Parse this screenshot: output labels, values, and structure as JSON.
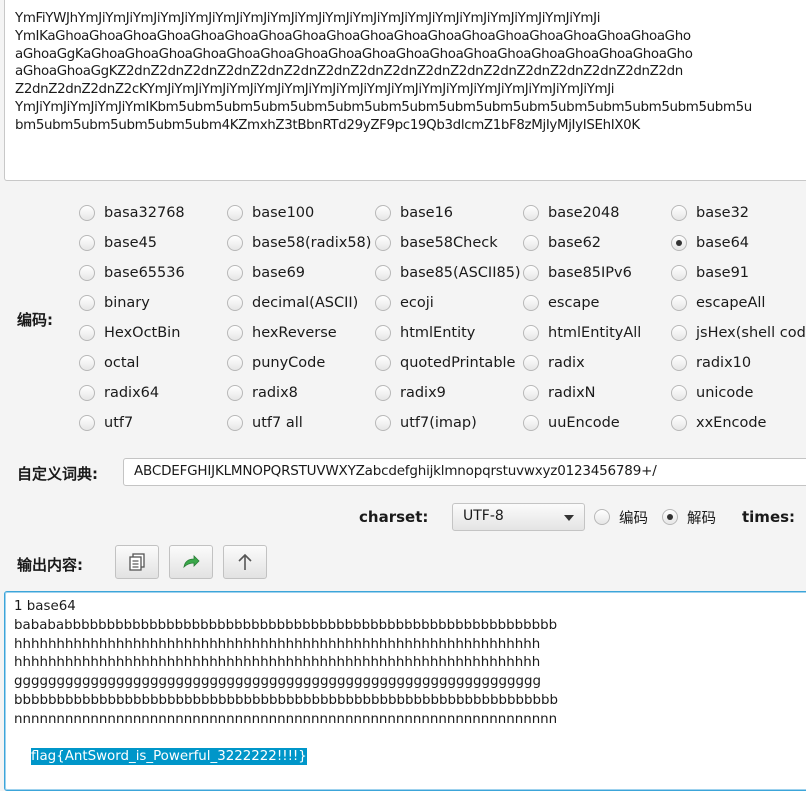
{
  "input_lines": [
    "YmFiYWJhYmJiYmJiYmJiYmJiYmJiYmJiYmJiYmJiYmJiYmJiYmJiYmJiYmJiYmJiYmJiYmJiYmJiYmJiYmJi",
    "YmIKaGhoaGhoaGhoaGhoaGhoaGhoaGhoaGhoaGhoaGhoaGhoaGhoaGhoaGhoaGhoaGhoaGhoaGhoaGho",
    "aGhoaGgKaGhoaGhoaGhoaGhoaGhoaGhoaGhoaGhoaGhoaGhoaGhoaGhoaGhoaGhoaGhoaGhoaGhoaGho",
    "aGhoaGhoaGgKZ2dnZ2dnZ2dnZ2dnZ2dnZ2dnZ2dnZ2dnZ2dnZ2dnZ2dnZ2dnZ2dnZ2dnZ2dnZ2dnZ2dn",
    "Z2dnZ2dnZ2dnZ2cKYmJiYmJiYmJiYmJiYmJiYmJiYmJiYmJiYmJiYmJiYmJiYmJiYmJiYmJiYmJiYmJiYmJi",
    "YmJiYmJiYmJiYmJiYmIKbm5ubm5ubm5ubm5ubm5ubm5ubm5ubm5ubm5ubm5ubm5ubm5ubm5ubm5ubm5ubm5u",
    "bm5ubm5ubm5ubm5ubm5ubm4KZmxhZ3tBbnRTd29yZF9pc19Qb3dlcmZ1bF8zMjIyMjIyISEhIX0K"
  ],
  "encoding_label": "编码:",
  "options": [
    [
      "basa32768",
      "base100",
      "base16",
      "base2048",
      "base32"
    ],
    [
      "base45",
      "base58(radix58)",
      "base58Check",
      "base62",
      "base64"
    ],
    [
      "base65536",
      "base69",
      "base85(ASCII85)",
      "base85IPv6",
      "base91"
    ],
    [
      "binary",
      "decimal(ASCII)",
      "ecoji",
      "escape",
      "escapeAll"
    ],
    [
      "HexOctBin",
      "hexReverse",
      "htmlEntity",
      "htmlEntityAll",
      "jsHex(shell code)"
    ],
    [
      "octal",
      "punyCode",
      "quotedPrintable",
      "radix",
      "radix10"
    ],
    [
      "radix64",
      "radix8",
      "radix9",
      "radixN",
      "unicode"
    ],
    [
      "utf7",
      "utf7 all",
      "utf7(imap)",
      "uuEncode",
      "xxEncode"
    ]
  ],
  "selected_option": "base64",
  "dict_label": "自定义词典:",
  "dict_value": "ABCDEFGHIJKLMNOPQRSTUVWXYZabcdefghijklmnopqrstuvwxyz0123456789+/",
  "charset_label": "charset:",
  "charset_value": "UTF-8",
  "mode_encode": "编码",
  "mode_decode": "解码",
  "mode_selected": "decode",
  "times_label": "times:",
  "output_label": "输出内容:",
  "toolbar_icons": [
    "copy-icon",
    "share-arrow-icon",
    "up-arrow-icon"
  ],
  "colors": {
    "accent": "#0096c9",
    "share_icon": "#3aa84a"
  },
  "output_lines": [
    "1 base64",
    "babababbbbbbbbbbbbbbbbbbbbbbbbbbbbbbbbbbbbbbbbbbbbbbbbbbbbbbbbbb",
    "hhhhhhhhhhhhhhhhhhhhhhhhhhhhhhhhhhhhhhhhhhhhhhhhhhhhhhhhhhhhhh",
    "hhhhhhhhhhhhhhhhhhhhhhhhhhhhhhhhhhhhhhhhhhhhhhhhhhhhhhhhhhhhhh",
    "gggggggggggggggggggggggggggggggggggggggggggggggggggggggggggggg",
    "bbbbbbbbbbbbbbbbbbbbbbbbbbbbbbbbbbbbbbbbbbbbbbbbbbbbbbbbbbbbbbbb",
    "nnnnnnnnnnnnnnnnnnnnnnnnnnnnnnnnnnnnnnnnnnnnnnnnnnnnnnnnnnnnnnnn"
  ],
  "output_selected_line": "flag{AntSword_is_Powerful_3222222!!!!}"
}
